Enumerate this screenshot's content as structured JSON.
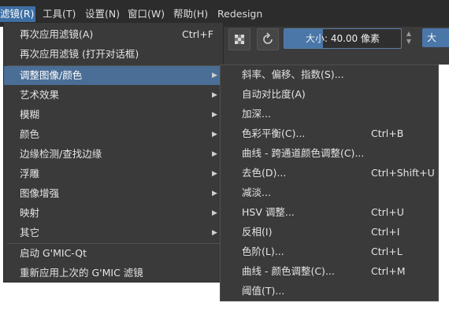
{
  "menubar": {
    "items": [
      {
        "label": "滤镜(R)",
        "active": true
      },
      {
        "label": "工具(T)",
        "active": false
      },
      {
        "label": "设置(N)",
        "active": false
      },
      {
        "label": "窗口(W)",
        "active": false
      },
      {
        "label": "帮助(H)",
        "active": false
      },
      {
        "label": "Redesign",
        "active": false
      }
    ]
  },
  "toolbar": {
    "size_label": "大小: 40.00 像素",
    "size_value_fraction": 0.33,
    "right_button_label": "大",
    "spin_up": "▲",
    "spin_down": "▼"
  },
  "filter_menu": {
    "items": [
      {
        "label": "再次应用滤镜(A)",
        "shortcut": "Ctrl+F"
      },
      {
        "label": "再次应用滤镜 (打开对话框)",
        "shortcut": ""
      },
      {
        "label": "调整图像/颜色",
        "shortcut": "",
        "submenu": true,
        "highlighted": true
      },
      {
        "label": "艺术效果",
        "shortcut": "",
        "submenu": true
      },
      {
        "label": "模糊",
        "shortcut": "",
        "submenu": true
      },
      {
        "label": "颜色",
        "shortcut": "",
        "submenu": true
      },
      {
        "label": "边缘检测/查找边缘",
        "shortcut": "",
        "submenu": true
      },
      {
        "label": "浮雕",
        "shortcut": "",
        "submenu": true
      },
      {
        "label": "图像增强",
        "shortcut": "",
        "submenu": true
      },
      {
        "label": "映射",
        "shortcut": "",
        "submenu": true
      },
      {
        "label": "其它",
        "shortcut": "",
        "submenu": true
      },
      {
        "label": "启动 G'MIC-Qt",
        "shortcut": ""
      },
      {
        "label": "重新应用上次的 G'MIC 滤镜",
        "shortcut": ""
      }
    ],
    "submenu_arrow": "▶"
  },
  "adjust_submenu": {
    "items": [
      {
        "label": "斜率、偏移、指数(S)...",
        "shortcut": ""
      },
      {
        "label": "自动对比度(A)",
        "shortcut": ""
      },
      {
        "label": "加深...",
        "shortcut": ""
      },
      {
        "label": "色彩平衡(C)...",
        "shortcut": "Ctrl+B"
      },
      {
        "label": "曲线 - 跨通道颜色调整(C)...",
        "shortcut": ""
      },
      {
        "label": "去色(D)...",
        "shortcut": "Ctrl+Shift+U"
      },
      {
        "label": "减淡...",
        "shortcut": ""
      },
      {
        "label": "HSV 调整...",
        "shortcut": "Ctrl+U"
      },
      {
        "label": "反相(I)",
        "shortcut": "Ctrl+I"
      },
      {
        "label": "色阶(L)...",
        "shortcut": "Ctrl+L"
      },
      {
        "label": "曲线 - 颜色调整(C)...",
        "shortcut": "Ctrl+M"
      },
      {
        "label": "阈值(T)...",
        "shortcut": ""
      }
    ]
  },
  "colors": {
    "accent": "#4b6e96",
    "menu_bg": "#3a3a3a",
    "menubar_bg": "#2c2c2c"
  }
}
